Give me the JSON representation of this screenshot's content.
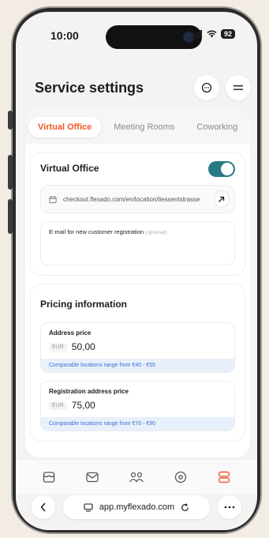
{
  "status": {
    "time": "10:00",
    "battery": "92"
  },
  "header": {
    "title": "Service settings",
    "chat_icon": "chat-bubble-icon",
    "menu_icon": "hamburger-menu-icon"
  },
  "tabs": [
    {
      "label": "Virtual Office",
      "active": true
    },
    {
      "label": "Meeting Rooms",
      "active": false
    },
    {
      "label": "Coworking",
      "active": false
    }
  ],
  "virtual_office": {
    "title": "Virtual Office",
    "enabled": true,
    "checkout_url": "checkout.flexado.com/en/location/liessentstrasse",
    "email_label": "E-mail for new customer registration",
    "email_optional": "(optional)"
  },
  "pricing": {
    "title": "Pricing information",
    "items": [
      {
        "label": "Address price",
        "currency": "EUR",
        "value": "50,00",
        "range": "Comparable locations range from €40 - €55"
      },
      {
        "label": "Registration address price",
        "currency": "EUR",
        "value": "75,00",
        "range": "Comparable locations range from €70 - €90"
      }
    ]
  },
  "bottom_nav": [
    {
      "icon": "storefront-icon"
    },
    {
      "icon": "mail-icon"
    },
    {
      "icon": "users-icon"
    },
    {
      "icon": "location-pin-icon"
    },
    {
      "icon": "services-icon",
      "active": true
    }
  ],
  "browser": {
    "url": "app.myflexado.com"
  },
  "colors": {
    "accent": "#f05a28",
    "toggle": "#2a7a86",
    "info": "#3c6fd1"
  }
}
